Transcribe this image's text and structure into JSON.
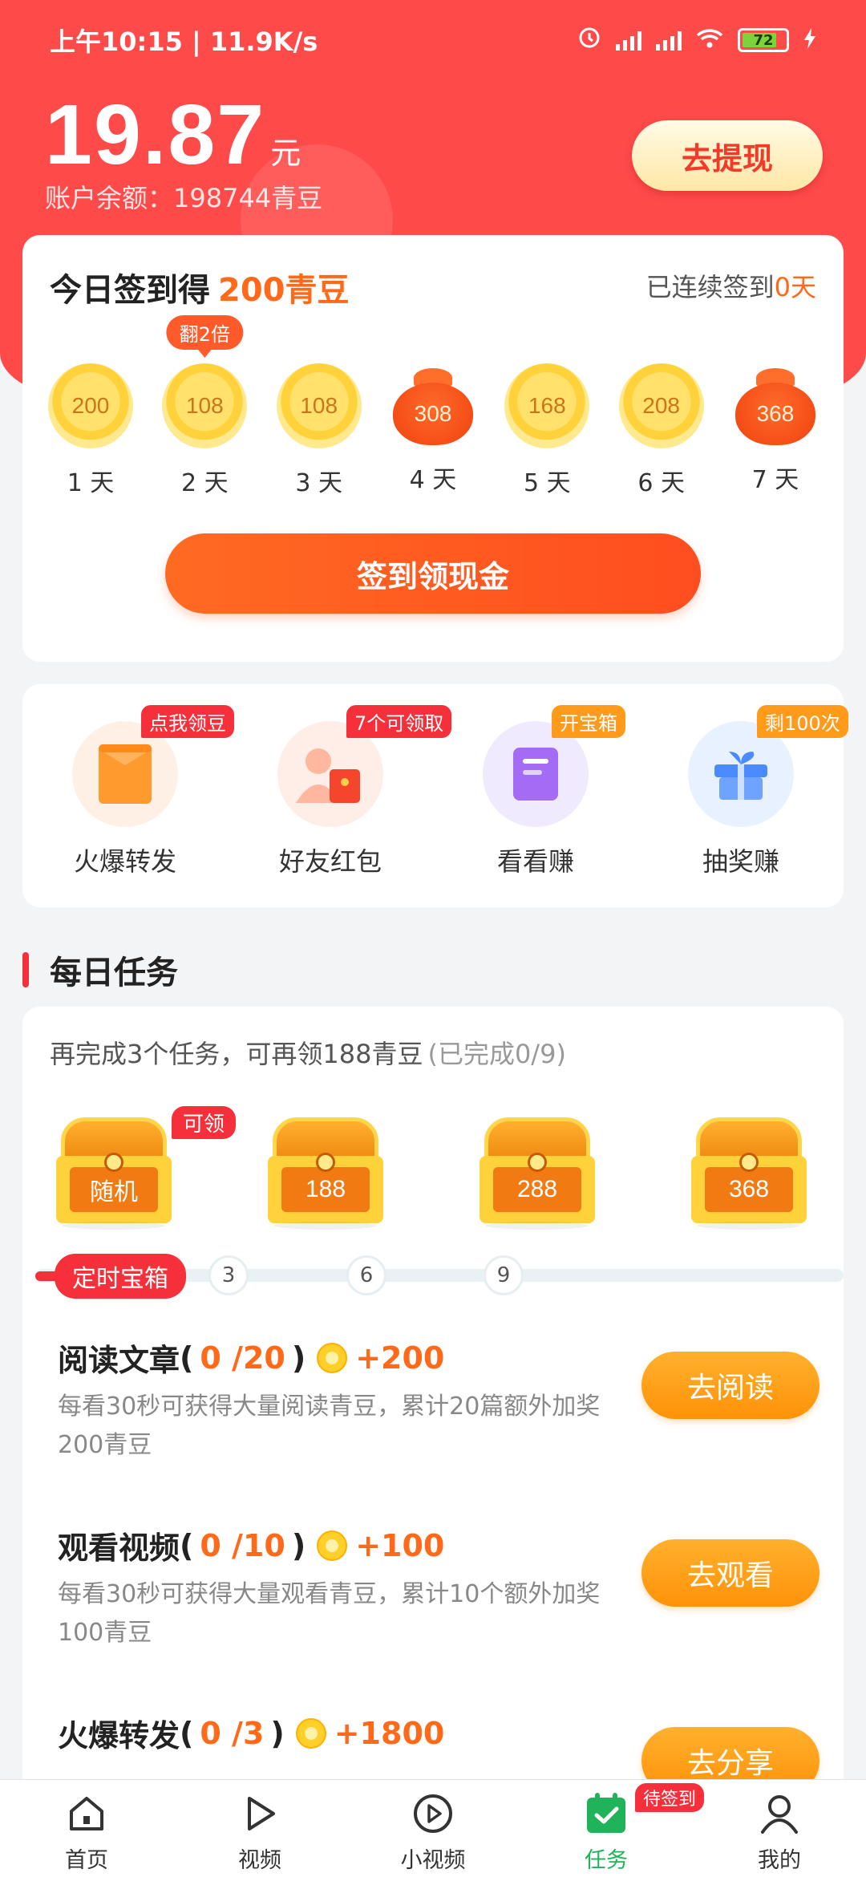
{
  "status_bar": {
    "time": "上午10:15 | 11.9K/s",
    "battery": "72"
  },
  "account": {
    "balance": "19.87",
    "unit": "元",
    "sub": "账户余额：198744青豆",
    "withdraw_label": "去提现"
  },
  "signin": {
    "title": "今日签到得",
    "title_reward": "200青豆",
    "streak_prefix": "已连续签到",
    "streak_days": "0天",
    "double_tag": "翻2倍",
    "days": [
      {
        "value": "200",
        "label": "1 天",
        "kind": "coin"
      },
      {
        "value": "108",
        "label": "2 天",
        "kind": "coin"
      },
      {
        "value": "108",
        "label": "3 天",
        "kind": "coin"
      },
      {
        "value": "308",
        "label": "4 天",
        "kind": "bag"
      },
      {
        "value": "168",
        "label": "5 天",
        "kind": "coin"
      },
      {
        "value": "208",
        "label": "6 天",
        "kind": "coin"
      },
      {
        "value": "368",
        "label": "7 天",
        "kind": "bag"
      }
    ],
    "button": "签到领现金"
  },
  "quick_actions": [
    {
      "name": "火爆转发",
      "tag": "点我领豆",
      "tag_color": "#f5303a",
      "icon": "envelope-icon"
    },
    {
      "name": "好友红包",
      "tag": "7个可领取",
      "tag_color": "#f5303a",
      "icon": "friend-redpacket-icon"
    },
    {
      "name": "看看赚",
      "tag": "开宝箱",
      "tag_color": "#ff9a1a",
      "icon": "document-icon"
    },
    {
      "name": "抽奖赚",
      "tag": "剩100次",
      "tag_color": "#ff9a1a",
      "icon": "gift-icon"
    }
  ],
  "daily_tasks": {
    "heading": "每日任务",
    "hint": "再完成3个任务，可再领188青豆",
    "hint_progress": "(已完成0/9)",
    "chests": [
      {
        "label": "随机",
        "claim": "可领"
      },
      {
        "label": "188"
      },
      {
        "label": "288"
      },
      {
        "label": "368"
      }
    ],
    "timer_label": "定时宝箱",
    "milestones": [
      "3",
      "6",
      "9"
    ],
    "tasks": [
      {
        "name": "阅读文章",
        "progress": "0 /20",
        "reward": "+200",
        "desc": "每看30秒可获得大量阅读青豆，累计20篇额外加奖200青豆",
        "button": "去阅读"
      },
      {
        "name": "观看视频",
        "progress": "0 /10",
        "reward": "+100",
        "desc": "每看30秒可获得大量观看青豆，累计10个额外加奖100青豆",
        "button": "去观看"
      },
      {
        "name": "火爆转发",
        "progress": "0 /3",
        "reward": "+1800",
        "desc": "",
        "button": "去分享"
      }
    ]
  },
  "bottom_nav": [
    {
      "label": "首页",
      "icon": "home-icon"
    },
    {
      "label": "视频",
      "icon": "play-icon"
    },
    {
      "label": "小视频",
      "icon": "play-circle-icon"
    },
    {
      "label": "任务",
      "icon": "task-check-icon",
      "badge": "待签到",
      "active": true
    },
    {
      "label": "我的",
      "icon": "user-icon"
    }
  ],
  "colors": {
    "header": "#ff4a4a",
    "accent": "#ff6a1a",
    "active_nav": "#21b35a"
  }
}
